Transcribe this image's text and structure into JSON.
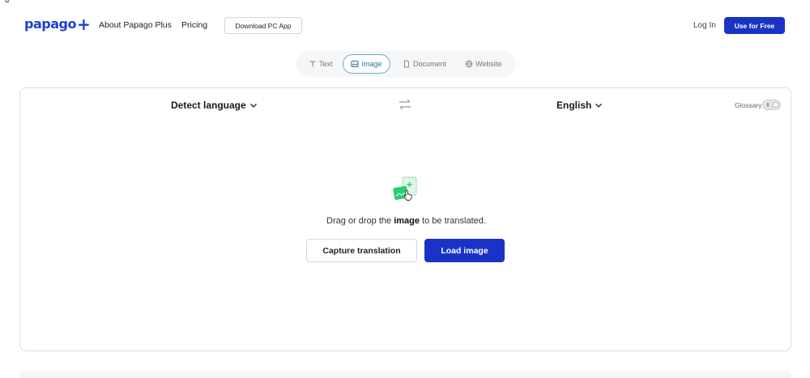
{
  "header": {
    "logo": "papago",
    "nav": {
      "about": "About Papago Plus",
      "pricing": "Pricing",
      "download": "Download PC App"
    },
    "login": "Log In",
    "cta": "Use for Free"
  },
  "tabs": [
    {
      "label": "Text",
      "icon": "text-icon",
      "active": false
    },
    {
      "label": "Image",
      "icon": "image-icon",
      "active": true
    },
    {
      "label": "Document",
      "icon": "document-icon",
      "active": false
    },
    {
      "label": "Website",
      "icon": "globe-icon",
      "active": false
    }
  ],
  "translator": {
    "source_language": "Detect language",
    "target_language": "English",
    "glossary_label": "Glossary",
    "glossary_enabled": false,
    "drop_text_before": "Drag or drop the ",
    "drop_text_bold": "image",
    "drop_text_after": " to be translated.",
    "capture_button": "Capture translation",
    "load_button": "Load image"
  },
  "colors": {
    "brand": "#1b3fd8",
    "primary_button": "#1a33c6",
    "active_tab_border": "#6cb0c9",
    "illustration_green": "#2ecc71"
  }
}
